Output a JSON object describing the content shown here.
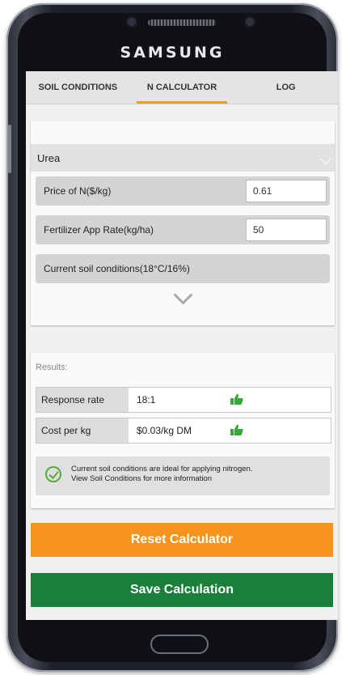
{
  "device": {
    "brand": "SAMSUNG"
  },
  "tabs": [
    {
      "label": "SOIL CONDITIONS",
      "active": false
    },
    {
      "label": "N CALCULATOR",
      "active": true
    },
    {
      "label": "LOG",
      "active": false
    }
  ],
  "calculator": {
    "fertilizer_select": "Urea",
    "price_label": "Price of N($/kg)",
    "price_value": "0.61",
    "app_rate_label": "Fertilizer App Rate(kg/ha)",
    "app_rate_value": "50",
    "soil_conditions_label": "Current soil conditions(18°C/16%)"
  },
  "results": {
    "title": "Results:",
    "rows": [
      {
        "label": "Response rate",
        "value": "18:1",
        "icon": "thumbs-up-icon"
      },
      {
        "label": "Cost per kg",
        "value": "$0.03/kg DM",
        "icon": "thumbs-up-icon"
      }
    ],
    "note_line1": "Current soil conditions are ideal for applying nitrogen.",
    "note_line2": "View Soil Conditions for more information"
  },
  "actions": {
    "reset_label": "Reset Calculator",
    "save_label": "Save Calculation"
  },
  "colors": {
    "accent_orange": "#f7941e",
    "accent_green": "#1b7f3c",
    "thumb_green": "#3aa63a"
  }
}
